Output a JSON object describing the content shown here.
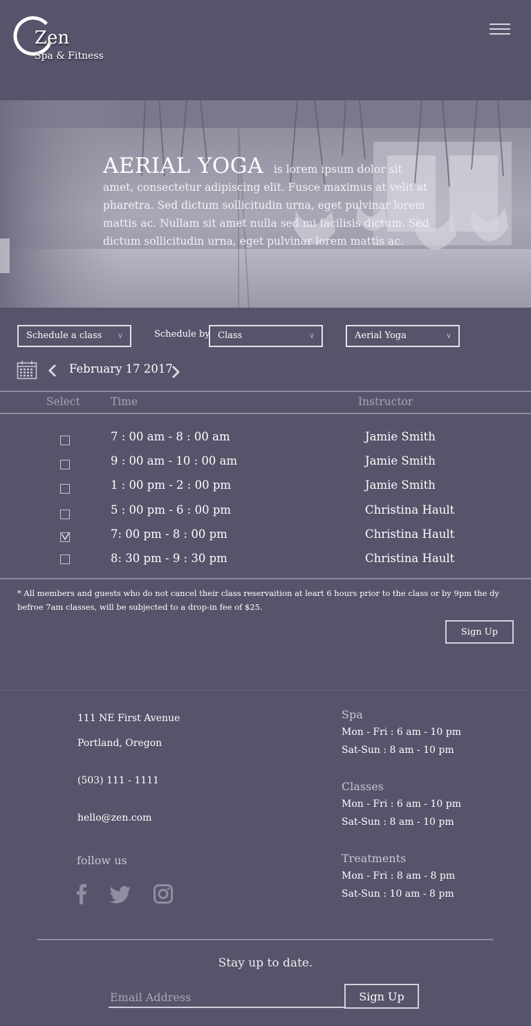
{
  "brand": {
    "name": "Zen",
    "tagline": "Spa & Fitness"
  },
  "header": {
    "menu_icon": "hamburger-menu-icon"
  },
  "hero": {
    "title": "AERIAL YOGA",
    "description": "is lorem ipsum dolor sit amet, consectetur adipiscing elit. Fusce maximus at velit at pharetra. Sed dictum sollicitudin urna, eget pulvinar lorem mattis ac. Nullam sit amet nulla sed mi facilisis dictum. Sed dictum sollicitudin urna, eget pulvinar lorem mattis ac."
  },
  "filters": {
    "action_select": "Schedule a class",
    "schedule_by_label": "Schedule by",
    "schedule_by_select": "Class",
    "class_select": "Aerial Yoga"
  },
  "date_nav": {
    "date": "February 17 2017",
    "calendar_icon": "calendar-icon",
    "prev_icon": "chevron-left-icon",
    "next_icon": "chevron-right-icon"
  },
  "schedule": {
    "headers": {
      "select": "Select",
      "time": "Time",
      "instructor": "Instructor"
    },
    "rows": [
      {
        "time": "7 : 00 am - 8 : 00 am",
        "instructor": "Jamie Smith",
        "selected": false
      },
      {
        "time": "9 : 00 am - 10 : 00 am",
        "instructor": "Jamie Smith",
        "selected": false
      },
      {
        "time": "1 : 00 pm - 2 : 00 pm",
        "instructor": "Jamie Smith",
        "selected": false
      },
      {
        "time": "5 : 00 pm - 6 : 00 pm",
        "instructor": "Christina Hault",
        "selected": false
      },
      {
        "time": "7: 00 pm - 8 : 00 pm",
        "instructor": "Christina Hault",
        "selected": true
      },
      {
        "time": "8: 30 pm - 9 : 30 pm",
        "instructor": "Christina Hault",
        "selected": false
      }
    ]
  },
  "disclaimer": "* All members and guests who do not cancel their class reservaition at leart 6 hours prior to the class or by 9pm the dy befroe 7am classes, will be subjected to a drop-in fee of $25.",
  "signup_button": "Sign Up",
  "footer": {
    "address_line1": "111 NE First Avenue",
    "address_line2": "Portland, Oregon",
    "phone": "(503) 111 - 1111",
    "email": "hello@zen.com",
    "follow_label": "follow us",
    "social_icons": [
      "facebook-icon",
      "twitter-icon",
      "instagram-icon"
    ],
    "hours": {
      "spa_title": "Spa",
      "spa_weekday": "Mon - Fri :  6 am - 10 pm",
      "spa_weekend": "Sat-Sun : 8 am - 10 pm",
      "classes_title": "Classes",
      "classes_weekday": "Mon - Fri :  6 am - 10 pm",
      "classes_weekend": "Sat-Sun :  8 am - 10 pm",
      "treatments_title": "Treatments",
      "treatments_weekday": "Mon - Fri :  8 am - 8 pm",
      "treatments_weekend": "Sat-Sun :  10 am - 8 pm"
    }
  },
  "newsletter": {
    "title": "Stay up to date.",
    "email_placeholder": "Email Address",
    "button": "Sign Up"
  },
  "colors": {
    "background": "#55546a",
    "rule": "#8e8ca0",
    "muted_text": "#a6a5b6"
  }
}
